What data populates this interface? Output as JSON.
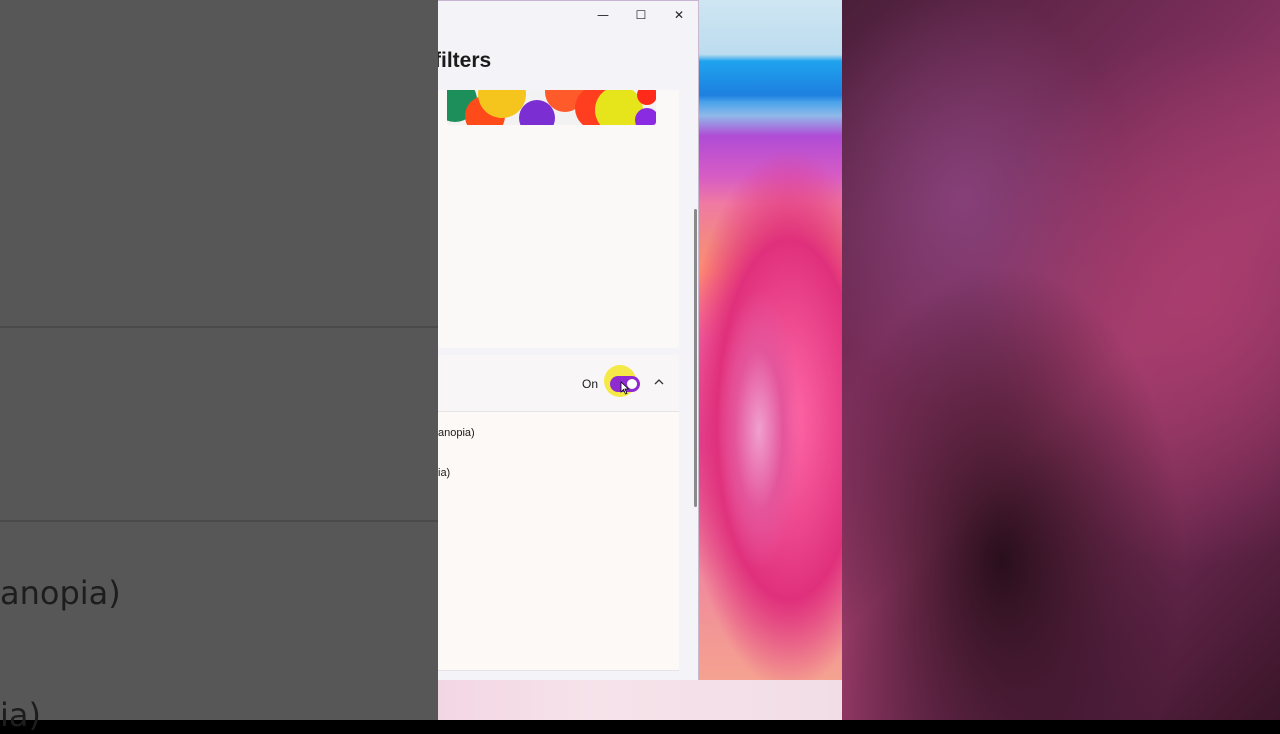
{
  "left_background": {
    "text_lines": [
      "anopia)",
      "ia)"
    ]
  },
  "window": {
    "title": "filters",
    "controls": {
      "minimize_glyph": "—",
      "maximize_glyph": "☐",
      "close_glyph": "✕"
    },
    "color_filters_row": {
      "state_label": "On",
      "toggle_on": true,
      "accent_color": "#8f2bd0",
      "chevron": "up-chevron-icon"
    },
    "filter_options": [
      "anopia)",
      "ia)"
    ]
  }
}
